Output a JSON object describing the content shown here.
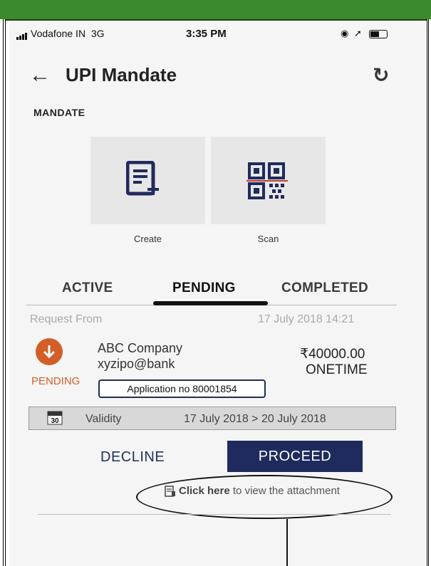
{
  "status_bar": {
    "carrier": "Vodafone IN",
    "network": "3G",
    "time": "3:35 PM"
  },
  "header": {
    "title": "UPI Mandate"
  },
  "mandate": {
    "section_label": "MANDATE",
    "tiles": [
      {
        "label": "Create",
        "icon": "create-document-icon"
      },
      {
        "label": "Scan",
        "icon": "qr-scan-icon"
      }
    ]
  },
  "tabs": [
    {
      "label": "ACTIVE"
    },
    {
      "label": "PENDING",
      "selected": true
    },
    {
      "label": "COMPLETED"
    }
  ],
  "request": {
    "from_label": "Request From",
    "date": "17 July 2018 14:21",
    "status": "PENDING",
    "company": "ABC Company",
    "vpa": "xyzipo@bank",
    "amount": "₹40000.00",
    "frequency": "ONETIME",
    "application": "Application no 80001854",
    "validity_label": "Validity",
    "validity_range": "17 July 2018 > 20 July 2018",
    "calendar_day": "30"
  },
  "actions": {
    "decline": "DECLINE",
    "proceed": "PROCEED",
    "attachment_link": "Click here",
    "attachment_rest": " to view the attachment"
  },
  "colors": {
    "accent_orange": "#d35f28",
    "navy": "#1f2b5d",
    "top_band": "#3c8a2e"
  }
}
